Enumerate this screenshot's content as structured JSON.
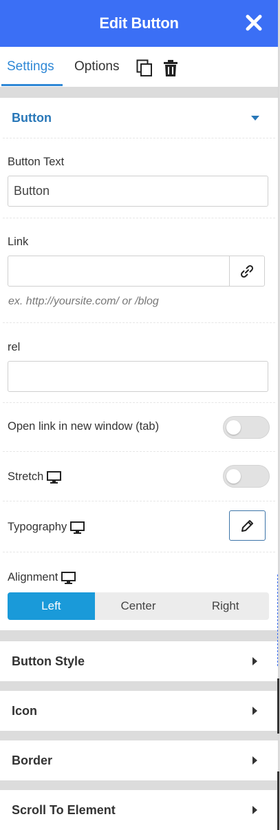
{
  "header": {
    "title": "Edit Button"
  },
  "tabs": {
    "settings": "Settings",
    "options": "Options"
  },
  "sections": {
    "button": "Button",
    "button_style": "Button Style",
    "icon": "Icon",
    "border": "Border",
    "scroll_to_element": "Scroll To Element"
  },
  "fields": {
    "button_text": {
      "label": "Button Text",
      "value": "Button"
    },
    "link": {
      "label": "Link",
      "value": "",
      "hint": "ex. http://yoursite.com/ or /blog"
    },
    "rel": {
      "label": "rel",
      "value": ""
    },
    "open_new_window": {
      "label": "Open link in new window (tab)",
      "on": false
    },
    "stretch": {
      "label": "Stretch",
      "on": false
    },
    "typography": {
      "label": "Typography"
    },
    "alignment": {
      "label": "Alignment",
      "options": [
        "Left",
        "Center",
        "Right"
      ],
      "selected": "Left"
    }
  },
  "colors": {
    "header_bg": "#3b6ff5",
    "accent": "#2f88d6",
    "selected": "#1a9ad9"
  }
}
